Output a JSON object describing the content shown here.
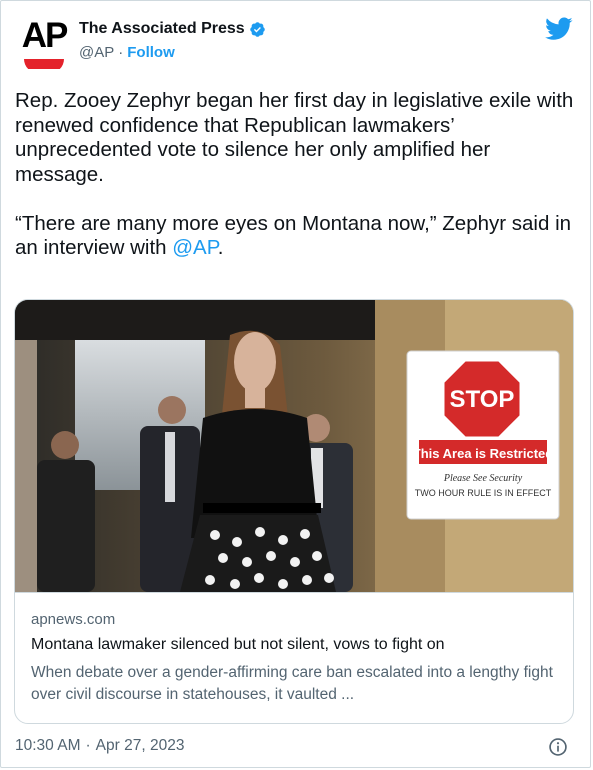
{
  "author": {
    "display_name": "The Associated Press",
    "handle": "@AP",
    "separator": "·",
    "follow_label": "Follow",
    "avatar_text": "AP",
    "verified": true
  },
  "tweet": {
    "paragraph_1": "Rep. Zooey Zephyr began her first day in legislative exile with renewed confidence that Republican lawmakers’ unprecedented vote to silence her only amplified her message.",
    "paragraph_2_prefix": "“There are many more eyes on Montana now,” Zephyr said in an interview with ",
    "paragraph_2_mention": "@AP",
    "paragraph_2_suffix": "."
  },
  "link_card": {
    "domain": "apnews.com",
    "title": "Montana lawmaker silenced but not silent, vows to fight on",
    "description": "When debate over a gender-affirming care ban escalated into a lengthy fight over civil discourse in statehouses, it vaulted ...",
    "photo_sign": {
      "stop": "STOP",
      "restricted": "This Area is Restricted",
      "line_1": "Please See Security",
      "line_2": "TWO HOUR RULE IS IN EFFECT"
    }
  },
  "footer": {
    "time": "10:30 AM",
    "separator": "·",
    "date": "Apr 27, 2023"
  },
  "icons": {
    "twitter": "twitter-bird-icon",
    "verified": "verified-badge-icon",
    "info": "info-icon"
  },
  "colors": {
    "accent": "#1d9bf0",
    "text": "#0f1419",
    "secondary": "#536471",
    "border": "#cfd9de",
    "ap_red": "#e4222b"
  }
}
